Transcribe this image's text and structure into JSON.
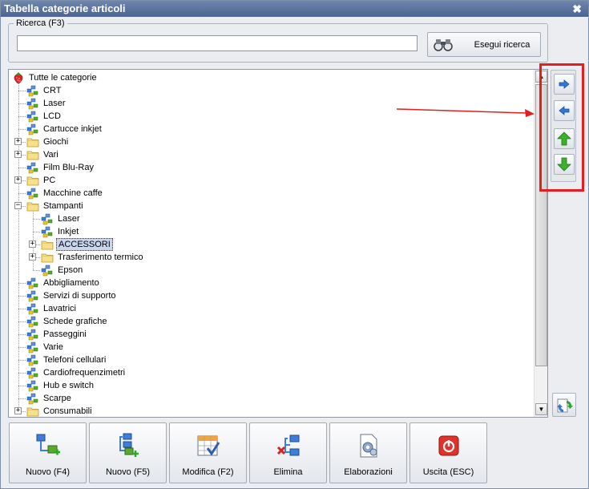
{
  "window": {
    "title": "Tabella categorie articoli",
    "close_glyph": "✖"
  },
  "search": {
    "group_label": "Ricerca (F3)",
    "value": "",
    "placeholder": "",
    "button_label": "Esegui ricerca",
    "button_icon": "binoculars-icon"
  },
  "tree": {
    "root": "Tutte le categorie",
    "items": [
      {
        "label": "CRT",
        "icon": "category-icon"
      },
      {
        "label": "Laser",
        "icon": "category-icon"
      },
      {
        "label": "LCD",
        "icon": "category-icon"
      },
      {
        "label": "Cartucce inkjet",
        "icon": "category-icon"
      },
      {
        "label": "Giochi",
        "icon": "folder-icon",
        "expander": "+"
      },
      {
        "label": "Vari",
        "icon": "folder-icon",
        "expander": "+"
      },
      {
        "label": "Film Blu-Ray",
        "icon": "category-icon"
      },
      {
        "label": "PC",
        "icon": "folder-icon",
        "expander": "+"
      },
      {
        "label": "Macchine caffe",
        "icon": "category-icon"
      },
      {
        "label": "Stampanti",
        "icon": "folder-icon",
        "expander": "−"
      },
      {
        "label": "Laser",
        "icon": "category-icon"
      },
      {
        "label": "Inkjet",
        "icon": "category-icon"
      },
      {
        "label": "ACCESSORI",
        "icon": "folder-icon",
        "expander": "+",
        "selected": true
      },
      {
        "label": "Trasferimento termico",
        "icon": "folder-icon",
        "expander": "+"
      },
      {
        "label": "Epson",
        "icon": "category-icon"
      },
      {
        "label": "Abbigliamento",
        "icon": "category-icon"
      },
      {
        "label": "Servizi di supporto",
        "icon": "category-icon"
      },
      {
        "label": "Lavatrici",
        "icon": "category-icon"
      },
      {
        "label": "Schede grafiche",
        "icon": "category-icon"
      },
      {
        "label": "Passeggini",
        "icon": "category-icon"
      },
      {
        "label": "Varie",
        "icon": "category-icon"
      },
      {
        "label": "Telefoni cellulari",
        "icon": "category-icon"
      },
      {
        "label": "Cardiofrequenzimetri",
        "icon": "category-icon"
      },
      {
        "label": "Hub e switch",
        "icon": "category-icon"
      },
      {
        "label": "Scarpe",
        "icon": "category-icon"
      },
      {
        "label": "Consumabili",
        "icon": "folder-icon",
        "expander": "+"
      }
    ]
  },
  "side_buttons": [
    {
      "name": "move-right-button",
      "icon": "arrow-right-icon"
    },
    {
      "name": "move-left-button",
      "icon": "arrow-left-icon"
    },
    {
      "name": "move-up-button",
      "icon": "arrow-up-icon"
    },
    {
      "name": "move-down-button",
      "icon": "arrow-down-icon"
    }
  ],
  "bottom_buttons": [
    {
      "label": "Nuovo (F4)",
      "icon": "new-sibling-icon"
    },
    {
      "label": "Nuovo (F5)",
      "icon": "new-child-icon"
    },
    {
      "label": "Modifica (F2)",
      "icon": "edit-icon"
    },
    {
      "label": "Elimina",
      "icon": "delete-icon"
    },
    {
      "label": "Elaborazioni",
      "icon": "processing-icon"
    },
    {
      "label": "Uscita (ESC)",
      "icon": "exit-icon"
    }
  ],
  "colors": {
    "titlebar": "#4b6391",
    "highlight": "#e41e1e",
    "arrow_blue": "#2f78d8",
    "arrow_green": "#3cb22b"
  }
}
